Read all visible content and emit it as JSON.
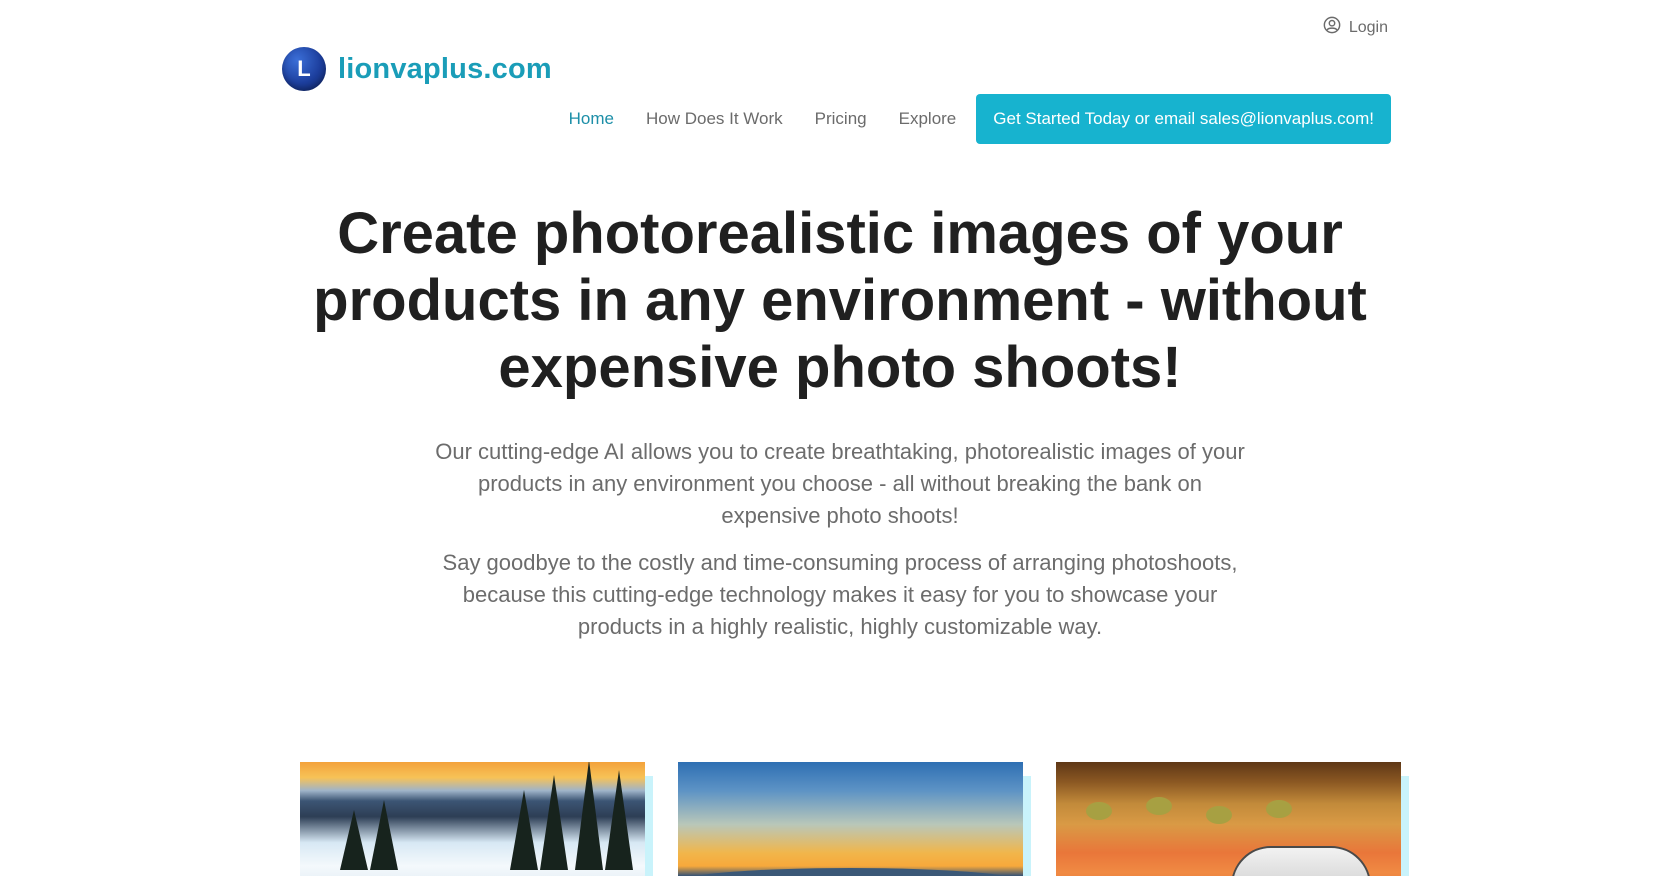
{
  "header": {
    "login_label": "Login",
    "brand_initial": "L",
    "brand_name": "lionvaplus.com"
  },
  "nav": {
    "items": [
      {
        "label": "Home",
        "active": true
      },
      {
        "label": "How Does It Work",
        "active": false
      },
      {
        "label": "Pricing",
        "active": false
      },
      {
        "label": "Explore",
        "active": false
      }
    ],
    "cta_label": "Get Started Today or email sales@lionvaplus.com!"
  },
  "hero": {
    "title": "Create photorealistic images of your products in any environment - without expensive photo shoots!",
    "paragraph1": "Our cutting-edge AI allows you to create breathtaking, photorealistic images of your products in any environment you choose - all without breaking the bank on expensive photo shoots!",
    "paragraph2": "Say goodbye to the costly and time-consuming process of arranging photoshoots, because this cutting-edge technology makes it easy for you to showcase your products in a highly realistic, highly customizable way."
  },
  "gallery": {
    "images": [
      {
        "name": "snowy-forest-image"
      },
      {
        "name": "lake-sunset-image"
      },
      {
        "name": "desert-car-image"
      }
    ]
  },
  "colors": {
    "brand": "#1a9db8",
    "cta": "#17b3cf",
    "active_nav": "#1d8fa8",
    "card_glow": "#c9f3fb"
  }
}
